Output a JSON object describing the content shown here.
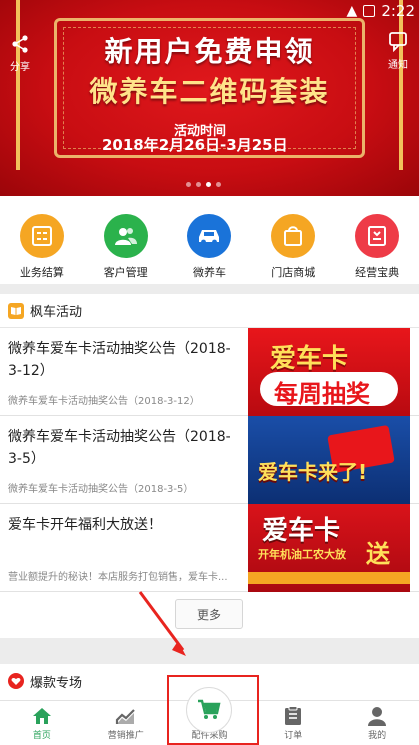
{
  "status_bar": {
    "time": "2:22"
  },
  "banner": {
    "share_label": "分享",
    "notice_label": "通知",
    "line1": "新用户免费申领",
    "line2": "微养车二维码套装",
    "time_label": "活动时间",
    "date_range": "2018年2月26日-3月25日",
    "dots_count": 4,
    "active_dot": 2
  },
  "quick_menu": [
    {
      "label": "业务结算",
      "color": "#f5a623",
      "icon": "calculator-icon"
    },
    {
      "label": "客户管理",
      "color": "#2bb24c",
      "icon": "users-icon"
    },
    {
      "label": "微养车",
      "color": "#1a73d9",
      "icon": "car-icon"
    },
    {
      "label": "门店商城",
      "color": "#f5a623",
      "icon": "shopping-bag-icon"
    },
    {
      "label": "经营宝典",
      "color": "#ee3b47",
      "icon": "book-icon"
    }
  ],
  "activity": {
    "title": "枫车活动",
    "items": [
      {
        "title": "微养车爱车卡活动抽奖公告（2018-3-12）",
        "desc": "微养车爱车卡活动抽奖公告（2018-3-12）",
        "image_text": [
          "爱车卡",
          "每周抽奖"
        ]
      },
      {
        "title": "微养车爱车卡活动抽奖公告（2018-3-5）",
        "desc": "微养车爱车卡活动抽奖公告（2018-3-5）",
        "image_text": [
          "爱车卡来了!"
        ]
      },
      {
        "title": "爱车卡开年福利大放送！",
        "desc": "营业额提升的秘诀！本店服务打包销售，爱车卡...",
        "image_text": [
          "爱车卡",
          "送",
          "开年机油工农大放"
        ]
      }
    ],
    "more_label": "更多"
  },
  "hot": {
    "title": "爆款专场"
  },
  "bottom_nav": [
    {
      "label": "首页",
      "icon": "home-icon",
      "active": true
    },
    {
      "label": "营销推广",
      "icon": "trend-chart-icon",
      "active": false
    },
    {
      "label": "配件采购",
      "icon": "cart-icon",
      "active": false
    },
    {
      "label": "订单",
      "icon": "order-icon",
      "active": false
    },
    {
      "label": "我的",
      "icon": "user-icon",
      "active": false
    }
  ],
  "colors": {
    "green": "#2aa25b",
    "red": "#e8241f",
    "orange": "#f5a623"
  }
}
